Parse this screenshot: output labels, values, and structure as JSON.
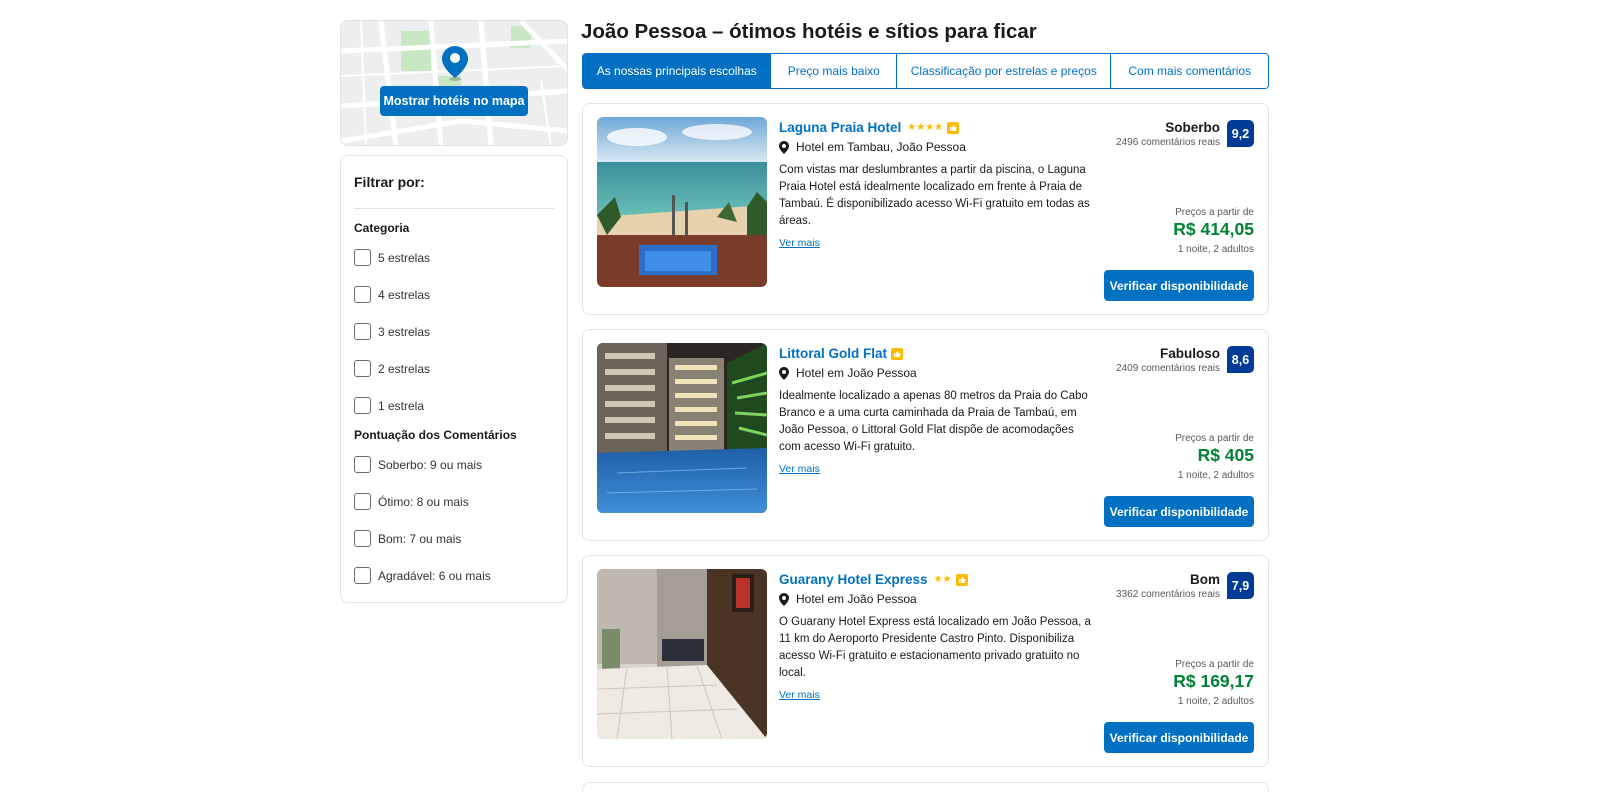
{
  "map": {
    "button_label": "Mostrar hotéis no mapa"
  },
  "filters": {
    "title": "Filtrar por:",
    "category_title": "Categoria",
    "categories": [
      "5 estrelas",
      "4 estrelas",
      "3 estrelas",
      "2 estrelas",
      "1 estrela"
    ],
    "review_title": "Pontuação dos Comentários",
    "reviews": [
      "Soberbo: 9 ou mais",
      "Ótimo: 8 ou mais",
      "Bom: 7 ou mais",
      "Agradável: 6 ou mais"
    ]
  },
  "page_title": "João Pessoa – ótimos hotéis e sítios para ficar",
  "tabs": [
    {
      "label": "As nossas principais escolhas",
      "active": true
    },
    {
      "label": "Preço mais baixo",
      "active": false
    },
    {
      "label": "Classificação por estrelas e preços",
      "active": false
    },
    {
      "label": "Com mais comentários",
      "active": false
    }
  ],
  "hotels": [
    {
      "name": "Laguna Praia Hotel",
      "stars": "★★★★",
      "location": "Hotel em Tambau, João Pessoa",
      "description": "Com vistas mar deslumbrantes a partir da piscina, o Laguna Praia Hotel está idealmente localizado em frente à Praia de Tambaú. É disponibilizado acesso Wi-Fi gratuito em todas as áreas.",
      "more": "Ver mais",
      "score_word": "Soberbo",
      "reviews": "2496 comentários reais",
      "score": "9,2",
      "price_label": "Preços a partir de",
      "price": "R$ 414,05",
      "nights": "1 noite, 2 adultos",
      "button": "Verificar disponibilidade"
    },
    {
      "name": "Littoral Gold Flat",
      "stars": "",
      "location": "Hotel em João Pessoa",
      "description": "Idealmente localizado a apenas 80 metros da Praia do Cabo Branco e a uma curta caminhada da Praia de Tambaú, em João Pessoa, o Littoral Gold Flat dispõe de acomodações com acesso Wi-Fi gratuito.",
      "more": "Ver mais",
      "score_word": "Fabuloso",
      "reviews": "2409 comentários reais",
      "score": "8,6",
      "price_label": "Preços a partir de",
      "price": "R$ 405",
      "nights": "1 noite, 2 adultos",
      "button": "Verificar disponibilidade"
    },
    {
      "name": "Guarany Hotel Express",
      "stars": "★★",
      "location": "Hotel em João Pessoa",
      "description": "O Guarany Hotel Express está localizado em João Pessoa, a 11 km do Aeroporto Presidente Castro Pinto. Disponibiliza acesso Wi-Fi gratuito e estacionamento privado gratuito no local.",
      "more": "Ver mais",
      "score_word": "Bom",
      "reviews": "3362 comentários reais",
      "score": "7,9",
      "price_label": "Preços a partir de",
      "price": "R$ 169,17",
      "nights": "1 noite, 2 adultos",
      "button": "Verificar disponibilidade"
    }
  ]
}
